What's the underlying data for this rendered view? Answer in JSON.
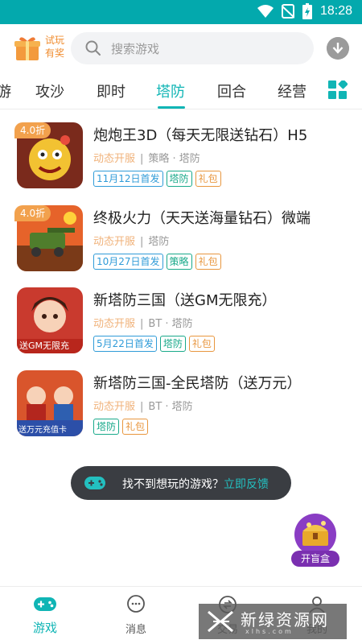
{
  "status_bar": {
    "time": "18:28"
  },
  "header": {
    "gift_label": "试玩有奖",
    "search_placeholder": "搜索游戏"
  },
  "tabs": [
    {
      "label": "游"
    },
    {
      "label": "攻沙"
    },
    {
      "label": "即时"
    },
    {
      "label": "塔防",
      "active": true
    },
    {
      "label": "回合"
    },
    {
      "label": "经营"
    }
  ],
  "games": [
    {
      "discount": "4.0折",
      "title": "炮炮王3D（每天无限送钻石）H5",
      "open_label": "动态开服",
      "category": "策略 · 塔防",
      "tags": [
        "11月12日首发",
        "塔防",
        "礼包"
      ]
    },
    {
      "discount": "4.0折",
      "title": "终极火力（天天送海量钻石）微端",
      "open_label": "动态开服",
      "category": "塔防",
      "tags": [
        "10月27日首发",
        "策略",
        "礼包"
      ]
    },
    {
      "discount": "",
      "title": "新塔防三国（送GM无限充）",
      "open_label": "动态开服",
      "category": "BT · 塔防",
      "tags": [
        "5月22日首发",
        "塔防",
        "礼包"
      ],
      "thumb_text": "送GM无限充"
    },
    {
      "discount": "",
      "title": "新塔防三国-全民塔防（送万元）",
      "open_label": "动态开服",
      "category": "BT · 塔防",
      "tags": [
        "塔防",
        "礼包"
      ],
      "thumb_text": "送万元充值卡"
    }
  ],
  "feedback": {
    "text": "找不到想玩的游戏？",
    "link": "立即反馈"
  },
  "blind_box": {
    "label": "开盲盒"
  },
  "bottom_nav": [
    {
      "label": "游戏",
      "active": true
    },
    {
      "label": "消息"
    },
    {
      "label": "交易"
    },
    {
      "label": "我的"
    }
  ],
  "watermark": {
    "text": "新绿资源网",
    "sub": "xlhs.com"
  },
  "colors": {
    "accent": "#10b5b5",
    "status_bar": "#03a9ad",
    "discount": "#f2a14d"
  }
}
